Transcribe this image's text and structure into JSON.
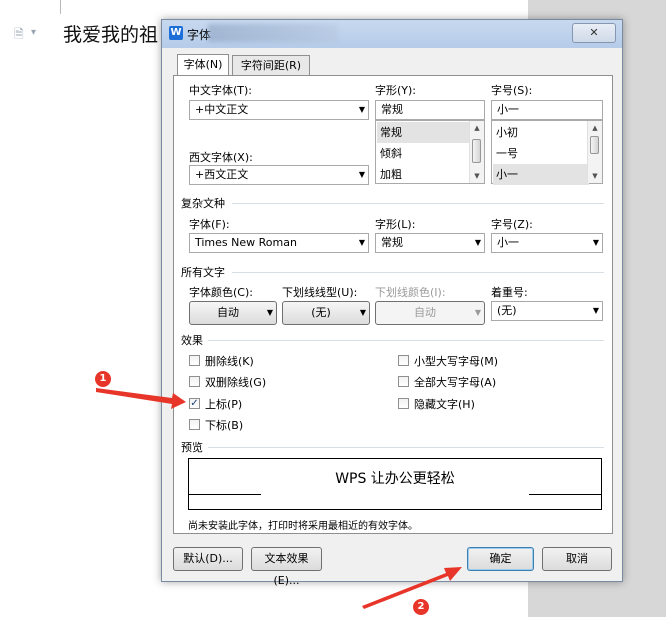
{
  "document": {
    "text": "我爱我的祖",
    "icon": "document-icon",
    "dropdown_glyph": "▾"
  },
  "dialog": {
    "app_icon_glyph": "W",
    "title": "字体",
    "close_glyph": "✕",
    "tabs": [
      {
        "label": "字体(N)",
        "active": true
      },
      {
        "label": "字符间距(R)",
        "active": false
      }
    ],
    "chinese_font": {
      "label": "中文字体(T):",
      "value": "+中文正文"
    },
    "western_font": {
      "label": "西文字体(X):",
      "value": "+西文正文"
    },
    "style": {
      "label": "字形(Y):",
      "value": "常规",
      "options": [
        "常规",
        "倾斜",
        "加粗"
      ],
      "selected": "常规"
    },
    "size": {
      "label": "字号(S):",
      "value": "小一",
      "options": [
        "小初",
        "一号",
        "小一"
      ],
      "selected": "小一"
    },
    "complex": {
      "section": "复杂文种",
      "font_label": "字体(F):",
      "font_value": "Times New Roman",
      "style_label": "字形(L):",
      "style_value": "常规",
      "size_label": "字号(Z):",
      "size_value": "小一"
    },
    "all_text": {
      "section": "所有文字",
      "color_label": "字体颜色(C):",
      "color_value": "自动",
      "underline_label": "下划线线型(U):",
      "underline_value": "(无)",
      "underline_color_label": "下划线颜色(I):",
      "underline_color_value": "自动",
      "emphasis_label": "着重号:",
      "emphasis_value": "(无)"
    },
    "effects": {
      "section": "效果",
      "strikethrough": {
        "label": "删除线(K)",
        "checked": false
      },
      "double_strikethrough": {
        "label": "双删除线(G)",
        "checked": false
      },
      "superscript": {
        "label": "上标(P)",
        "checked": true
      },
      "subscript": {
        "label": "下标(B)",
        "checked": false
      },
      "small_caps": {
        "label": "小型大写字母(M)",
        "checked": false
      },
      "all_caps": {
        "label": "全部大写字母(A)",
        "checked": false
      },
      "hidden": {
        "label": "隐藏文字(H)",
        "checked": false
      }
    },
    "preview": {
      "section": "预览",
      "text": "WPS 让办公更轻松",
      "note": "尚未安装此字体，打印时将采用最相近的有效字体。"
    },
    "buttons": {
      "default": "默认(D)...",
      "text_effect": "文本效果(E)...",
      "ok": "确定",
      "cancel": "取消"
    }
  },
  "annotations": [
    {
      "number": "1"
    },
    {
      "number": "2"
    }
  ],
  "colors": {
    "annotation": "#e8352a",
    "title_bar": "#b5cbe8",
    "check": "#1c3d74"
  }
}
